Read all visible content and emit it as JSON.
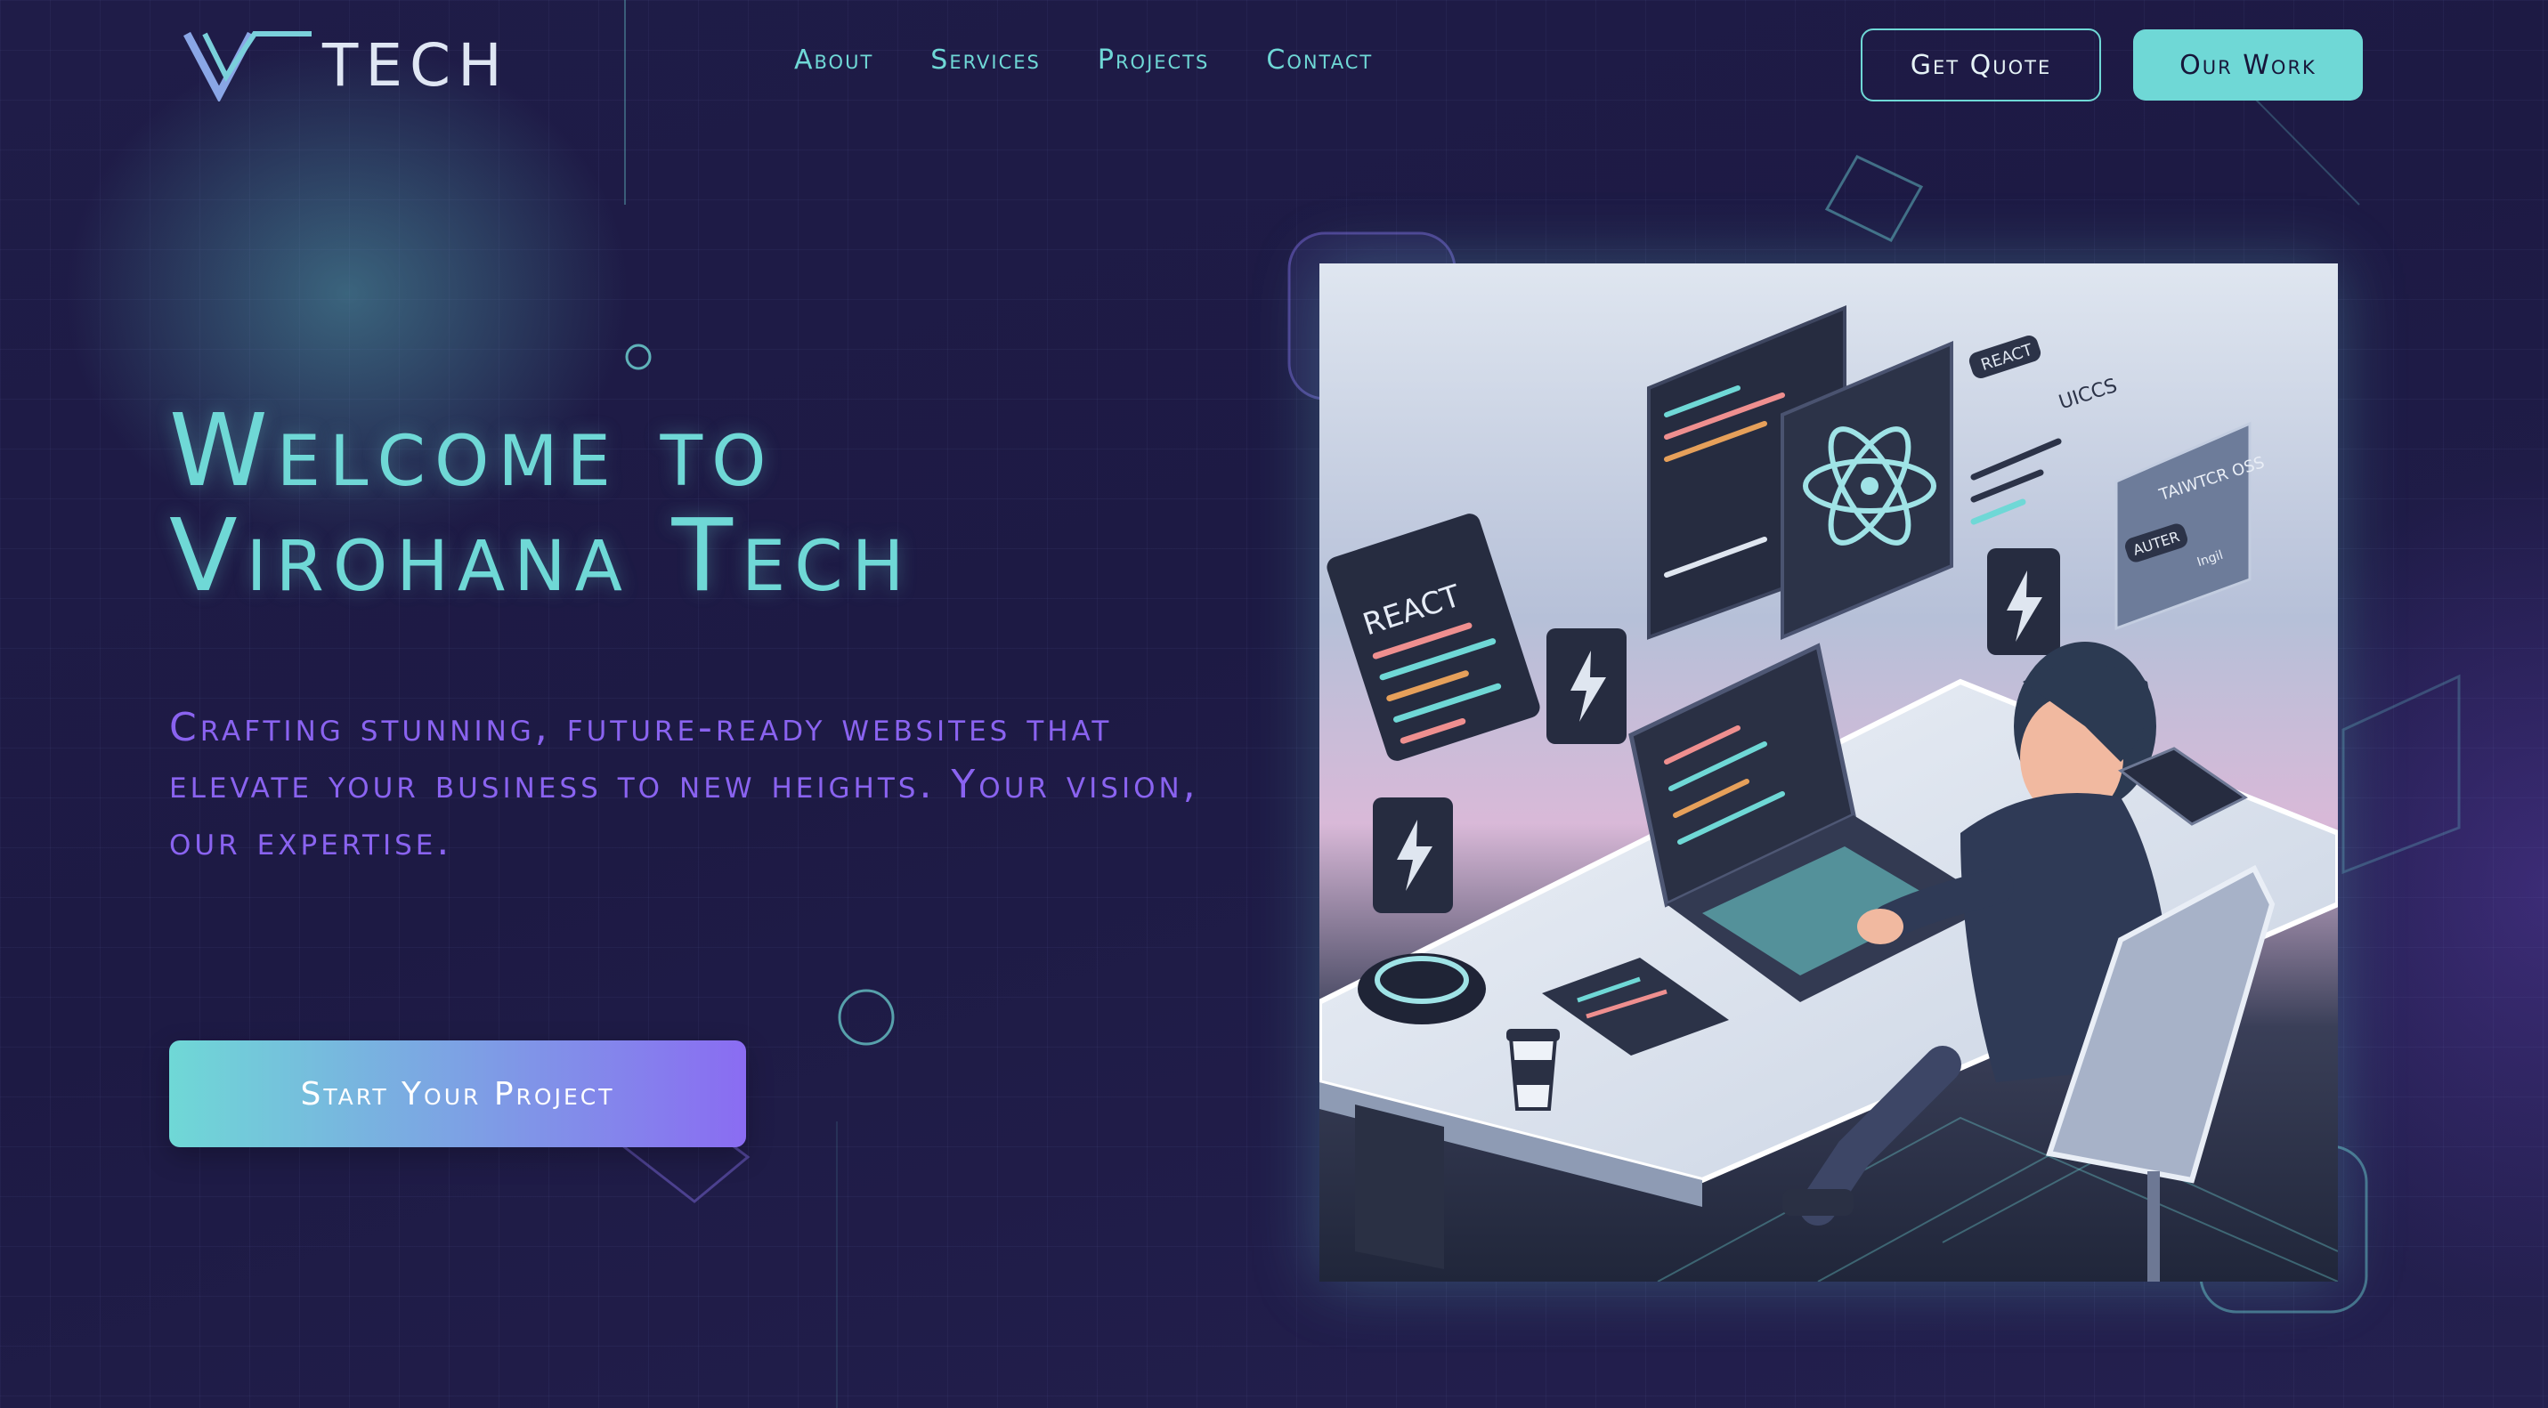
{
  "header": {
    "logo_text": "TECH",
    "nav": [
      "About",
      "Services",
      "Projects",
      "Contact"
    ],
    "quote_label": "Get Quote",
    "work_label": "Our Work"
  },
  "hero": {
    "title_line1": "Welcome to",
    "title_line2": "Virohana Tech",
    "subtitle": "Crafting stunning, future-ready websites that elevate your business to new heights. Your vision, our expertise.",
    "cta_label": "Start Your Project"
  },
  "illustration": {
    "panel_react": "REACT",
    "tag_react": "REACT",
    "tag_uiccs": "UICCS",
    "card_title": "TAIWTCR OSS",
    "card_button": "AUTER",
    "card_note": "Ingil"
  },
  "colors": {
    "accent_teal": "#6fd8d6",
    "accent_purple": "#8a63f0",
    "background": "#201d48"
  }
}
